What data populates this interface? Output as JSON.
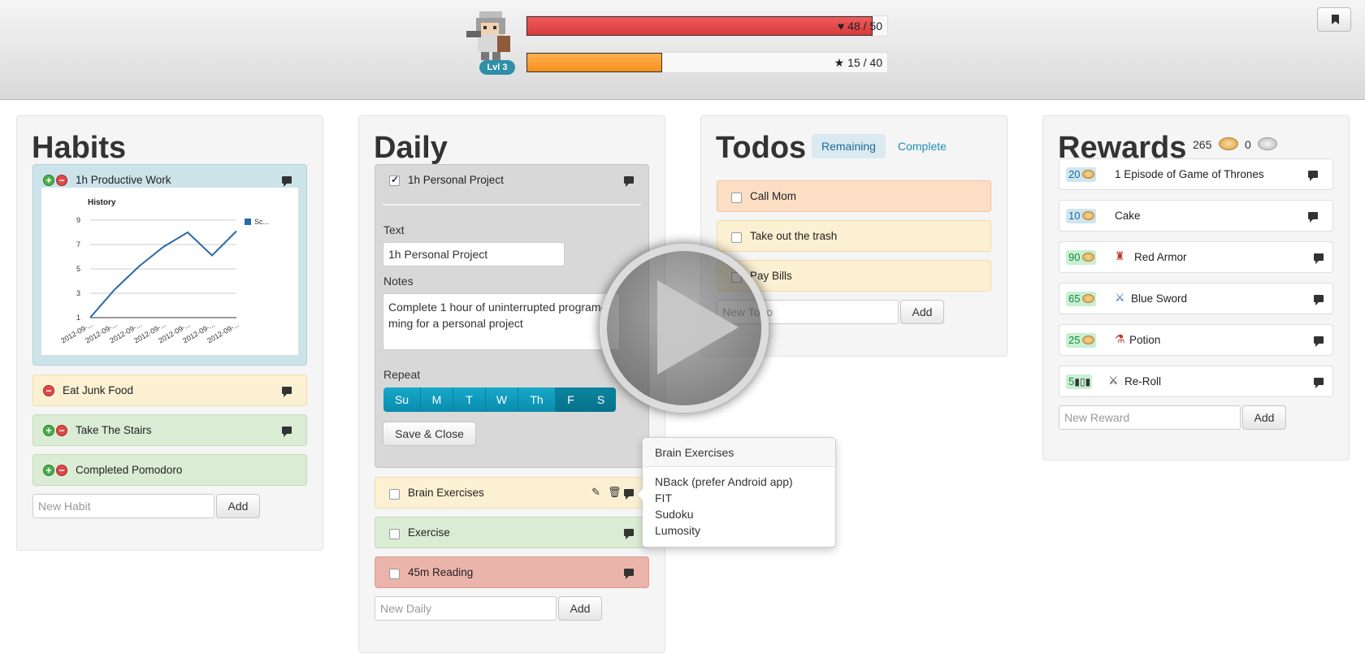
{
  "header": {
    "level": "Lvl 3",
    "hp": {
      "text": "48 / 50",
      "fraction": 0.96,
      "icon": "heart-icon"
    },
    "xp": {
      "text": "15 / 40",
      "fraction": 0.375,
      "icon": "star-icon"
    },
    "bookmark_icon": "bookmark-icon"
  },
  "habits": {
    "title": "Habits",
    "items": [
      {
        "label": "1h Productive Work"
      },
      {
        "label": "Eat Junk Food"
      },
      {
        "label": "Take The Stairs"
      },
      {
        "label": "Completed Pomodoro"
      }
    ],
    "new_placeholder": "New Habit",
    "add_label": "Add"
  },
  "chart_data": {
    "type": "line",
    "title": "History",
    "categories": [
      "2012-09-...",
      "2012-09-...",
      "2012-09-...",
      "2012-09-...",
      "2012-09-...",
      "2012-09-...",
      "2012-09-..."
    ],
    "series": [
      {
        "name": "Sc...",
        "values": [
          1,
          3.3,
          5.2,
          6.8,
          8,
          6.1,
          8.1
        ]
      }
    ],
    "yticks": [
      1,
      3,
      5,
      7,
      9
    ],
    "ylim": [
      1,
      9
    ],
    "legend": "right",
    "color": "#2b6aa8"
  },
  "daily": {
    "title": "Daily",
    "edit": {
      "task_label": "1h Personal Project",
      "text_label": "Text",
      "text_value": "1h Personal Project",
      "notes_label": "Notes",
      "notes_value": "Complete 1 hour of uninterrupted program­ming for a personal project",
      "repeat_label": "Repeat",
      "days": [
        "Su",
        "M",
        "T",
        "W",
        "Th",
        "F",
        "S"
      ],
      "save_label": "Save & Close"
    },
    "items": [
      {
        "label": "Brain Exercises"
      },
      {
        "label": "Exercise"
      },
      {
        "label": "45m Reading"
      }
    ],
    "new_placeholder": "New Daily",
    "add_label": "Add"
  },
  "todos": {
    "title": "Todos",
    "tab_remaining": "Remaining",
    "tab_complete": "Complete",
    "items": [
      {
        "label": "Call Mom"
      },
      {
        "label": "Take out the trash"
      },
      {
        "label": "Pay Bills"
      }
    ],
    "new_placeholder": "New Todo",
    "add_label": "Add"
  },
  "rewards": {
    "title": "Rewards",
    "gold": "265",
    "silver": "0",
    "items": [
      {
        "price": "20",
        "label": "1 Episode of Game of Thrones",
        "icon": ""
      },
      {
        "price": "10",
        "label": "Cake",
        "icon": ""
      },
      {
        "price": "90",
        "label": "Red Armor",
        "icon": "armor-icon"
      },
      {
        "price": "65",
        "label": "Blue Sword",
        "icon": "sword-icon"
      },
      {
        "price": "25",
        "label": "Potion",
        "icon": "potion-icon"
      },
      {
        "price": "5",
        "label": "Re-Roll",
        "icon": "reroll-icon"
      }
    ],
    "new_placeholder": "New Reward",
    "add_label": "Add"
  },
  "popover": {
    "title": "Brain Exercises",
    "lines": [
      "NBack (prefer Android app)",
      "FIT",
      "Sudoku",
      "Lumosity"
    ]
  }
}
